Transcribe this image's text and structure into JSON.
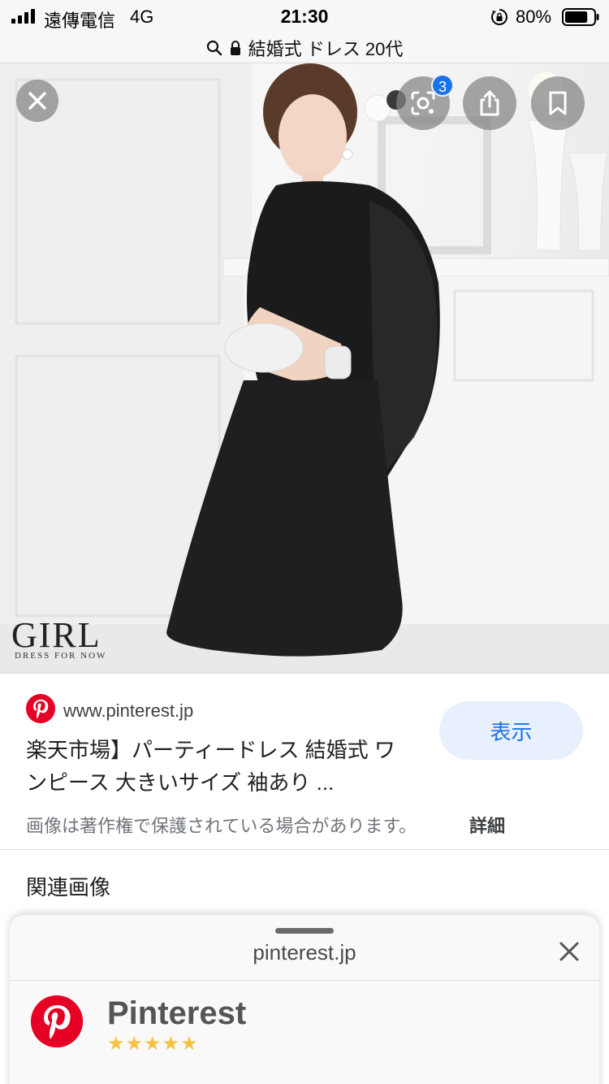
{
  "status_bar": {
    "carrier": "遠傳電信",
    "network": "4G",
    "time": "21:30",
    "battery": "80%",
    "battery_level": 0.8
  },
  "url_bar": {
    "query": "結婚式 ドレス 20代",
    "icons": [
      "search-icon",
      "lock-icon"
    ]
  },
  "viewer": {
    "lens_badge_count": "3",
    "icons": [
      "close-icon",
      "lens-icon",
      "share-icon",
      "bookmark-icon"
    ],
    "image_watermark": {
      "logo": "GIRL",
      "tagline": "DRESS FOR NOW"
    }
  },
  "info": {
    "source_domain": "www.pinterest.jp",
    "title": "楽天市場】パーティードレス 結婚式 ワンピース 大きいサイズ 袖あり ...",
    "visit_label": "表示",
    "copyright_notice": "画像は著作権で保護されている場合があります。",
    "details_label": "詳細"
  },
  "related": {
    "heading": "関連画像"
  },
  "app_banner": {
    "domain": "pinterest.jp",
    "app_name": "Pinterest",
    "rating_stars": 5,
    "rating_display": "★★★★★",
    "colors": {
      "brand": "#e60023",
      "stars": "#f5c242"
    }
  },
  "colors": {
    "accent": "#1a73e8",
    "visit_button_bg": "#e8f0fe",
    "pinterest_red": "#e60023"
  }
}
